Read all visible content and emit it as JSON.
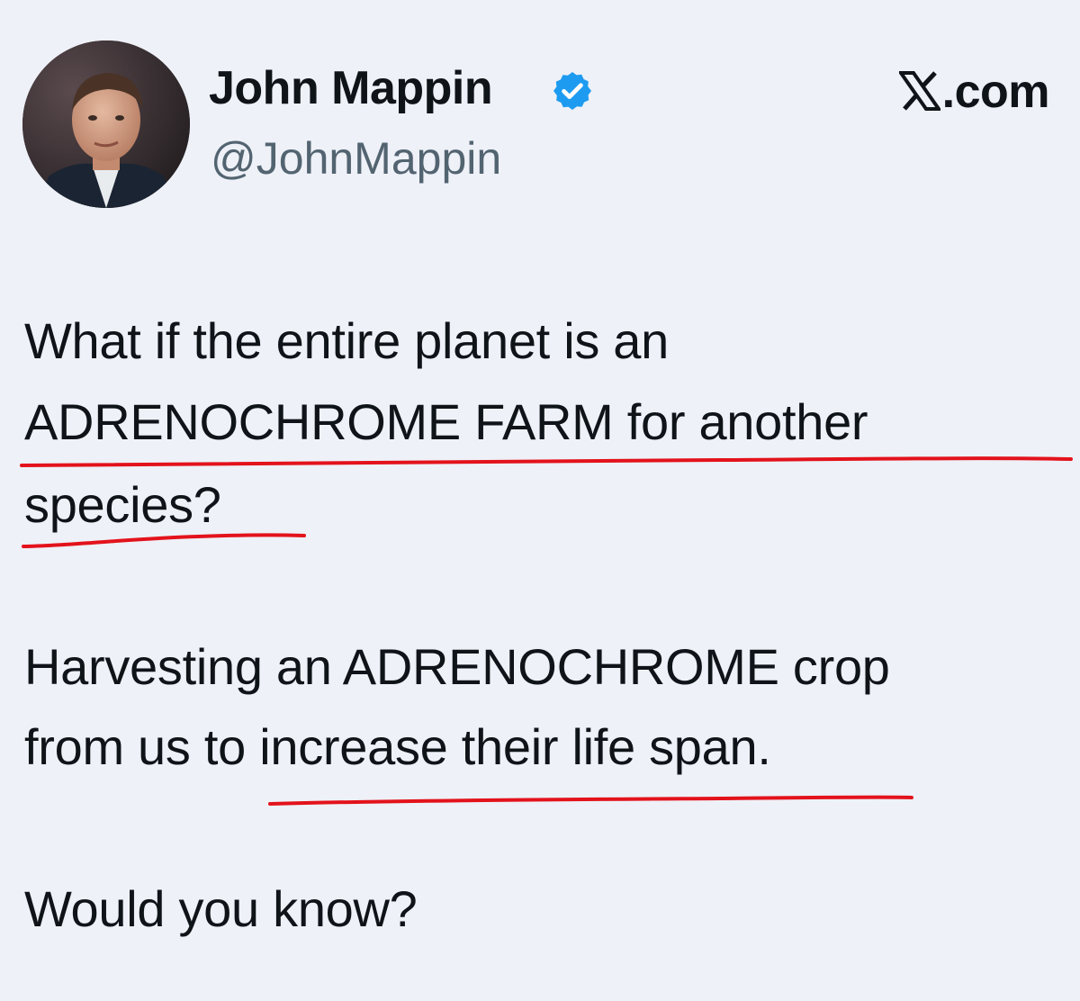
{
  "author": {
    "display_name": "John Mappin",
    "handle": "@JohnMappin",
    "verified_badge_icon": "verified-check-icon",
    "verified_color": "#1d9bf0"
  },
  "site": {
    "logo_icon": "x-logo-icon",
    "suffix": ".com"
  },
  "tweet": {
    "lines": [
      "What if the entire planet is an",
      "ADRENOCHROME FARM for another",
      "species?",
      "Harvesting an ADRENOCHROME crop",
      "from us to increase their life span.",
      "Would you know?"
    ]
  },
  "annotation": {
    "underline_color": "#e3121b"
  }
}
